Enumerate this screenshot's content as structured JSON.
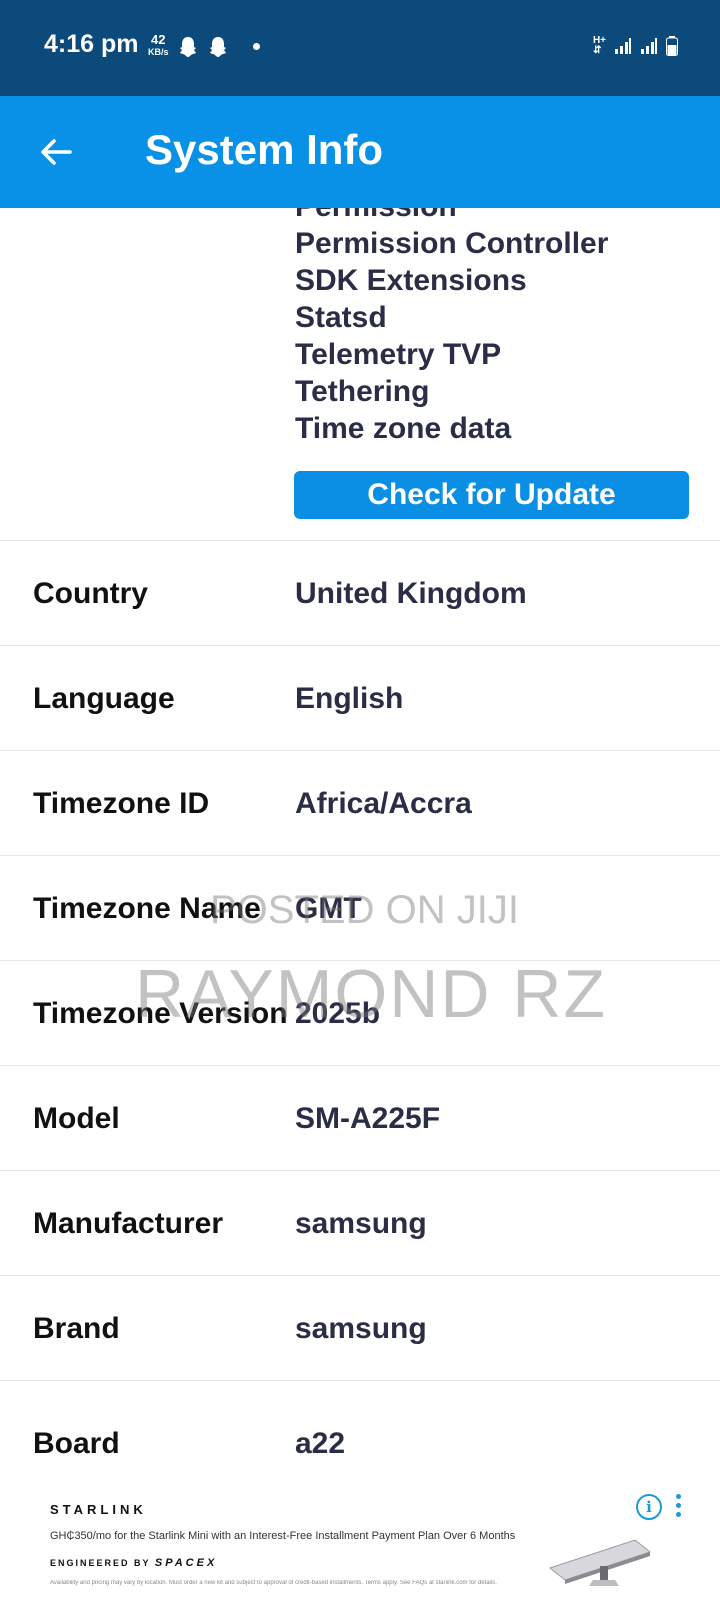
{
  "status_bar": {
    "time": "4:16 pm",
    "speed_value": "42",
    "speed_unit": "KB/s",
    "network_label": "H+"
  },
  "app_bar": {
    "title": "System Info",
    "color": "#0891e6"
  },
  "modules": [
    "Permission",
    "Permission Controller",
    "SDK Extensions",
    "Statsd",
    "Telemetry TVP",
    "Tethering",
    "Time zone data"
  ],
  "update_button": "Check for Update",
  "rows": [
    {
      "label": "Country",
      "value": "United Kingdom"
    },
    {
      "label": "Language",
      "value": "English"
    },
    {
      "label": "Timezone ID",
      "value": "Africa/Accra"
    },
    {
      "label": "Timezone Name",
      "value": "GMT"
    },
    {
      "label": "Timezone Version",
      "value": "2025b"
    },
    {
      "label": "Model",
      "value": "SM-A225F"
    },
    {
      "label": "Manufacturer",
      "value": "samsung"
    },
    {
      "label": "Brand",
      "value": "samsung"
    },
    {
      "label": "Board",
      "value": "a22"
    }
  ],
  "watermark": {
    "line1": "POSTED ON JIJI",
    "line2": "RAYMOND RZ"
  },
  "ad": {
    "brand": "STARLINK",
    "text": "GH₵350/mo for the Starlink Mini with an Interest-Free Installment Payment Plan Over 6 Months",
    "engineered": "ENGINEERED BY",
    "spacex": "SPACEX",
    "fine_print": "Availability and pricing may vary by location. Must order a new kit and subject to approval of credit-based installments. Terms apply. See FAQs at starlink.com for details.",
    "info_symbol": "i"
  }
}
